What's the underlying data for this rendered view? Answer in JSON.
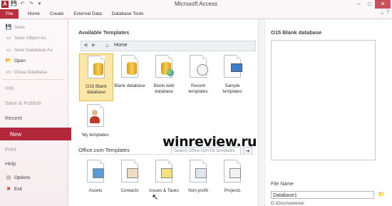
{
  "window": {
    "title": "Microsoft Access",
    "app_icon_letter": "A",
    "controls": [
      "–",
      "□",
      "✕"
    ]
  },
  "quick_access": [
    "💾",
    "↶",
    "↷",
    "▾"
  ],
  "ribbon": {
    "tabs": [
      "File",
      "Home",
      "Create",
      "External Data",
      "Database Tools"
    ],
    "right_icons": [
      "▵",
      "?"
    ]
  },
  "backstage": {
    "items": [
      {
        "label": "Save",
        "icon": "💾"
      },
      {
        "label": "Save Object As",
        "icon": "▭"
      },
      {
        "label": "Save Database As",
        "icon": "▭"
      },
      {
        "label": "Open",
        "icon": "📂"
      },
      {
        "label": "Close Database",
        "icon": "▭"
      }
    ],
    "info": "Info",
    "save_publish": "Save & Publish",
    "recent": "Recent",
    "new": "New",
    "print": "Print",
    "help": "Help",
    "options": "Options",
    "exit": "Exit",
    "accent": "#b3283a"
  },
  "templates": {
    "available_title": "Available Templates",
    "nav_back": "◀",
    "nav_forward": "▶",
    "home_label": "Home",
    "tiles": [
      {
        "label": "O15 Blank database",
        "selected": true
      },
      {
        "label": "Blank database"
      },
      {
        "label": "Blank web database"
      },
      {
        "label": "Recent templates"
      },
      {
        "label": "Sample templates"
      },
      {
        "label": "My templates"
      }
    ],
    "office_title": "Office.com Templates",
    "search_placeholder": "Search Office.com for templates",
    "search_go": "➜",
    "office_tiles": [
      {
        "label": "Assets"
      },
      {
        "label": "Contacts"
      },
      {
        "label": "Issues & Tasks"
      },
      {
        "label": "Non-profit"
      },
      {
        "label": "Projects"
      }
    ]
  },
  "watermark": "winreview.ru",
  "right_pane": {
    "title": "O15 Blank database",
    "file_name_label": "File Name",
    "file_name_value": "Database1",
    "path": "D:\\Docs\\serena\\"
  }
}
